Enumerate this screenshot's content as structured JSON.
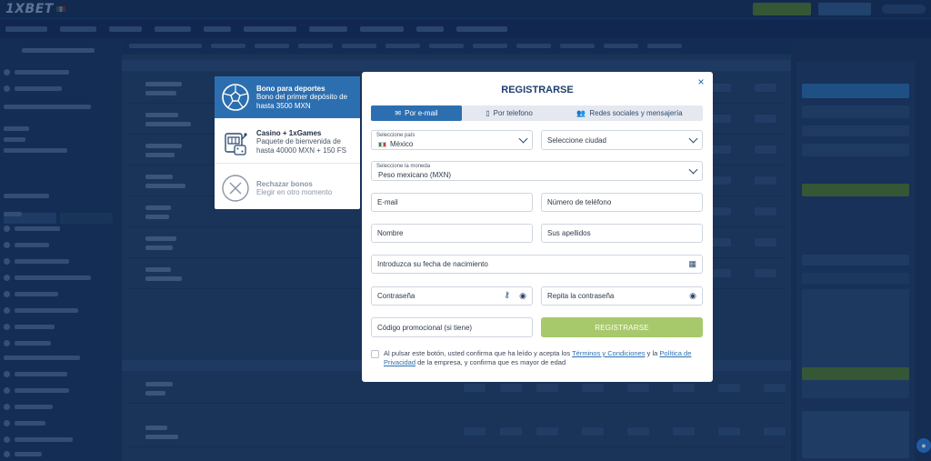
{
  "site": {
    "logo": "1XBET",
    "colors": {
      "accent": "#2c6fb1",
      "submit": "#a7c96b",
      "background": "#16325a"
    }
  },
  "bonus": {
    "items": [
      {
        "title": "Bono para deportes",
        "desc": "Bono del primer depósito de hasta 3500 MXN",
        "icon": "soccer-ball-icon",
        "active": true
      },
      {
        "title": "Casino + 1xGames",
        "desc": "Paquete de bienvenida de hasta 40000 MXN + 150 FS",
        "icon": "slot-machine-icon",
        "active": false
      },
      {
        "title": "Rechazar bonos",
        "desc": "Elegir en otro momento",
        "icon": "close-circle-icon",
        "active": false
      }
    ]
  },
  "modal": {
    "title": "REGISTRARSE",
    "close": "×",
    "tabs": [
      {
        "label": "Por e-mail",
        "icon": "email-icon",
        "active": true
      },
      {
        "label": "Por telefono",
        "icon": "phone-icon",
        "active": false
      },
      {
        "label": "Redes sociales y mensajería",
        "icon": "users-icon",
        "active": false
      }
    ],
    "fields": {
      "country_label": "Seleccione país",
      "country_value": "México",
      "city_placeholder": "Seleccione ciudad",
      "currency_label": "Seleccione la moneda",
      "currency_value": "Peso mexicano (MXN)",
      "email_placeholder": "E-mail",
      "phone_placeholder": "Número de teléfono",
      "name_placeholder": "Nombre",
      "surname_placeholder": "Sus apellidos",
      "birthdate_placeholder": "Introduzca su fecha de nacimiento",
      "password_placeholder": "Contraseña",
      "password_repeat_placeholder": "Repita la contraseña",
      "promo_placeholder": "Código promocional (si tiene)"
    },
    "submit_label": "REGISTRARSE",
    "consent": {
      "part1": "Al pulsar este botón, usted confirma que ha leído y acepta los ",
      "terms_link": "Términos y Condiciones",
      "part2": " y la ",
      "privacy_link": "Política de Privacidad",
      "part3": " de la empresa, y confirma que es mayor de edad"
    }
  }
}
